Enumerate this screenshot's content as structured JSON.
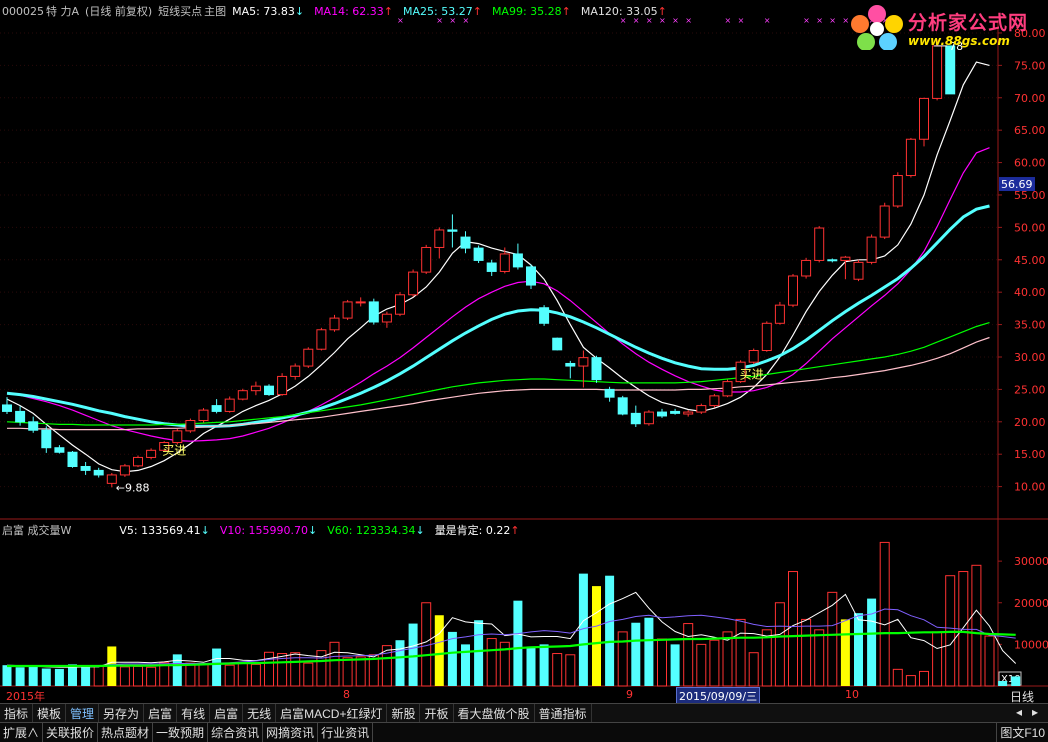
{
  "header": {
    "code": "000025",
    "name": "特 力A",
    "mode": "(日线 前复权)",
    "formula": "短线买点",
    "chart_label": "主图",
    "ma5": "MA5: 73.83",
    "ma14": "MA14: 62.33",
    "ma25": "MA25: 53.27",
    "ma99": "MA99: 35.28",
    "ma120": "MA120: 33.05"
  },
  "logo": {
    "title": "分析家公式网",
    "url": "www.88gs.com"
  },
  "volume_header": {
    "label": "启富 成交量W",
    "v5": "V5: 133569.41",
    "v10": "V10: 155990.70",
    "v60": "V60: 123334.34",
    "signal": "量是肯定: 0.22"
  },
  "price_axis": [
    "80.00",
    "75.00",
    "70.00",
    "65.00",
    "60.00",
    "55.00",
    "50.00",
    "45.00",
    "40.00",
    "35.00",
    "30.00",
    "25.00",
    "20.00",
    "15.00",
    "10.00"
  ],
  "price_marker": "56.69",
  "annotations": {
    "high": "78",
    "low": "9.88",
    "buy1": "买进",
    "buy2": "买进"
  },
  "volume_axis": [
    "30000",
    "20000",
    "10000"
  ],
  "volume_unit": "X10",
  "dates": {
    "start": "2015年",
    "m8": "8",
    "m9": "9",
    "cursor": "2015/09/09/三",
    "m10": "10"
  },
  "period": "日线",
  "toolbar": [
    "指标",
    "模板",
    "管理",
    "另存为",
    "启富",
    "有线",
    "启富",
    "无线",
    "启富MACD+红绿灯",
    "新股",
    "开板",
    "看大盘做个股",
    "普通指标"
  ],
  "toolbar_active": 2,
  "tabs": [
    "扩展∧",
    "关联报价",
    "热点题材",
    "一致预期",
    "综合资讯",
    "网摘资讯",
    "行业资讯"
  ],
  "tab_right": "图文F10",
  "colors": {
    "up": "#ff3232",
    "down": "#54ffff",
    "ma5": "#ffffff",
    "ma14": "#ff00ff",
    "ma25": "#54ffff",
    "ma99": "#00ff00",
    "ma120": "#ffc0cb",
    "signal": "#ffff00"
  },
  "chart_data": {
    "type": "candlestick",
    "ylim": [
      5,
      82
    ],
    "candles": [
      [
        22.6,
        23.8,
        21.2,
        21.6
      ],
      [
        21.6,
        22.4,
        19.4,
        20.0
      ],
      [
        20.0,
        20.8,
        18.3,
        18.7
      ],
      [
        18.7,
        19.3,
        15.2,
        16.0
      ],
      [
        16.0,
        16.4,
        15.1,
        15.3
      ],
      [
        15.3,
        15.5,
        12.9,
        13.1
      ],
      [
        13.1,
        13.8,
        11.8,
        12.5
      ],
      [
        12.5,
        12.9,
        11.4,
        11.8
      ],
      [
        10.5,
        12.1,
        9.88,
        11.8
      ],
      [
        11.8,
        13.5,
        11.5,
        13.2
      ],
      [
        13.2,
        14.8,
        13.0,
        14.5
      ],
      [
        14.5,
        15.9,
        14.2,
        15.6
      ],
      [
        15.6,
        17.0,
        15.4,
        16.8
      ],
      [
        16.8,
        18.9,
        16.5,
        18.6
      ],
      [
        18.6,
        20.5,
        18.3,
        20.2
      ],
      [
        20.2,
        22.1,
        19.9,
        21.8
      ],
      [
        22.5,
        23.5,
        21.3,
        21.6
      ],
      [
        21.6,
        23.9,
        21.4,
        23.5
      ],
      [
        23.5,
        25.1,
        23.3,
        24.8
      ],
      [
        24.8,
        26.2,
        24.1,
        25.5
      ],
      [
        25.5,
        25.8,
        24.0,
        24.2
      ],
      [
        24.2,
        27.5,
        24.0,
        27.0
      ],
      [
        27.0,
        29.0,
        26.5,
        28.6
      ],
      [
        28.6,
        31.5,
        28.3,
        31.2
      ],
      [
        31.2,
        34.5,
        31.0,
        34.2
      ],
      [
        34.2,
        36.5,
        33.9,
        36.0
      ],
      [
        36.0,
        38.8,
        35.7,
        38.5
      ],
      [
        38.5,
        39.2,
        37.8,
        38.5
      ],
      [
        38.5,
        39.0,
        35.0,
        35.4
      ],
      [
        35.4,
        37.0,
        34.5,
        36.6
      ],
      [
        36.6,
        40.0,
        36.3,
        39.6
      ],
      [
        39.6,
        43.5,
        39.3,
        43.1
      ],
      [
        43.1,
        47.3,
        42.8,
        46.9
      ],
      [
        46.9,
        50.0,
        45.2,
        49.6
      ],
      [
        49.6,
        52.0,
        46.9,
        49.4
      ],
      [
        48.5,
        49.4,
        46.0,
        46.8
      ],
      [
        46.8,
        47.2,
        44.5,
        44.9
      ],
      [
        44.5,
        45.0,
        42.5,
        43.2
      ],
      [
        43.2,
        46.9,
        42.9,
        45.9
      ],
      [
        45.9,
        47.5,
        43.5,
        43.9
      ],
      [
        43.9,
        44.3,
        40.5,
        41.1
      ],
      [
        37.6,
        38.0,
        34.8,
        35.2
      ],
      [
        32.9,
        33.0,
        31.0,
        31.1
      ],
      [
        29.0,
        29.4,
        26.7,
        28.6
      ],
      [
        28.6,
        31.0,
        25.3,
        29.9
      ],
      [
        29.9,
        30.2,
        26.0,
        26.5
      ],
      [
        25.0,
        25.4,
        23.1,
        23.8
      ],
      [
        23.7,
        24.0,
        21.0,
        21.2
      ],
      [
        21.3,
        22.5,
        19.2,
        19.7
      ],
      [
        19.7,
        21.8,
        19.4,
        21.5
      ],
      [
        21.5,
        22.0,
        20.6,
        20.9
      ],
      [
        21.6,
        22.0,
        21.1,
        21.3
      ],
      [
        21.2,
        21.8,
        20.8,
        21.5
      ],
      [
        21.5,
        22.8,
        21.2,
        22.5
      ],
      [
        22.5,
        24.3,
        22.2,
        24.0
      ],
      [
        24.0,
        26.5,
        23.8,
        26.2
      ],
      [
        26.2,
        29.5,
        26.0,
        29.2
      ],
      [
        29.2,
        31.3,
        28.9,
        31.0
      ],
      [
        31.0,
        35.5,
        30.8,
        35.2
      ],
      [
        35.2,
        38.5,
        35.0,
        38.0
      ],
      [
        38.0,
        42.8,
        37.7,
        42.5
      ],
      [
        42.5,
        45.3,
        42.1,
        44.9
      ],
      [
        44.9,
        50.2,
        44.6,
        49.9
      ],
      [
        45.0,
        45.2,
        44.6,
        44.9
      ],
      [
        44.9,
        45.6,
        42.0,
        45.4
      ],
      [
        42.0,
        45.0,
        41.7,
        44.6
      ],
      [
        44.6,
        48.9,
        44.3,
        48.5
      ],
      [
        48.5,
        53.8,
        48.2,
        53.3
      ],
      [
        53.3,
        58.5,
        53.0,
        58.0
      ],
      [
        58.0,
        63.8,
        57.7,
        63.6
      ],
      [
        63.6,
        70.0,
        62.5,
        69.9
      ],
      [
        69.9,
        79.0,
        69.6,
        78.0
      ],
      [
        78.0,
        78.0,
        70.6,
        70.6
      ]
    ],
    "ma_series": [
      {
        "name": "MA5",
        "values": [
          23.5,
          22.5,
          21.3,
          19.6,
          18.0,
          16.4,
          15.0,
          13.5,
          12.6,
          12.3,
          12.5,
          13.1,
          14.0,
          15.2,
          16.6,
          18.2,
          19.3,
          20.4,
          21.6,
          22.5,
          23.3,
          24.3,
          25.5,
          27.0,
          28.8,
          30.7,
          32.8,
          34.5,
          36.3,
          37.4,
          38.1,
          39.2,
          40.8,
          43.1,
          46.0,
          47.8,
          47.5,
          46.8,
          46.3,
          45.8,
          44.2,
          42.0,
          38.7,
          35.0,
          31.5,
          29.8,
          28.3,
          26.7,
          25.3,
          24.0,
          23.0,
          22.5,
          21.9,
          21.6,
          22.1,
          22.8,
          23.8,
          25.3,
          27.3,
          30.0,
          33.4,
          37.0,
          40.1,
          42.6,
          44.7,
          45.0,
          45.0,
          45.6,
          47.3,
          50.5,
          55.0,
          61.2,
          66.5,
          72.0,
          75.5,
          75.0
        ]
      },
      {
        "name": "MA14",
        "values": [
          24.4,
          24.1,
          23.6,
          23.1,
          22.5,
          21.8,
          21.0,
          20.2,
          19.4,
          18.8,
          18.3,
          17.8,
          17.4,
          17.1,
          17.0,
          17.1,
          17.2,
          17.4,
          17.8,
          18.4,
          19.0,
          19.8,
          20.7,
          21.6,
          22.6,
          23.7,
          24.9,
          26.1,
          27.4,
          28.6,
          29.9,
          31.4,
          33.0,
          34.6,
          36.2,
          37.7,
          39.0,
          40.0,
          40.9,
          41.5,
          41.7,
          41.3,
          40.2,
          38.7,
          37.0,
          35.3,
          33.6,
          32.0,
          30.5,
          29.2,
          28.1,
          27.1,
          26.2,
          25.5,
          24.9,
          24.6,
          24.6,
          24.8,
          25.3,
          26.1,
          27.3,
          29.0,
          30.9,
          32.8,
          34.5,
          36.2,
          37.9,
          39.5,
          41.3,
          43.5,
          46.3,
          50.1,
          54.3,
          58.4,
          61.5,
          62.3
        ]
      },
      {
        "name": "MA25",
        "values": [
          24.4,
          24.2,
          23.9,
          23.5,
          23.1,
          22.7,
          22.2,
          21.7,
          21.3,
          20.8,
          20.4,
          20.0,
          19.7,
          19.5,
          19.3,
          19.3,
          19.3,
          19.4,
          19.6,
          19.9,
          20.2,
          20.6,
          21.0,
          21.5,
          22.1,
          22.8,
          23.6,
          24.4,
          25.3,
          26.3,
          27.4,
          28.6,
          29.9,
          31.2,
          32.5,
          33.7,
          34.8,
          35.8,
          36.6,
          37.1,
          37.3,
          37.2,
          36.8,
          36.2,
          35.4,
          34.5,
          33.5,
          32.5,
          31.5,
          30.6,
          29.8,
          29.1,
          28.6,
          28.2,
          28.1,
          28.1,
          28.3,
          28.7,
          29.4,
          30.2,
          31.3,
          32.6,
          34.1,
          35.6,
          37.0,
          38.3,
          39.5,
          40.8,
          42.1,
          43.7,
          45.5,
          47.6,
          49.7,
          51.6,
          52.8,
          53.3
        ]
      },
      {
        "name": "MA99",
        "values": [
          20.0,
          19.9,
          19.8,
          19.7,
          19.6,
          19.6,
          19.5,
          19.5,
          19.5,
          19.5,
          19.5,
          19.5,
          19.6,
          19.6,
          19.7,
          19.8,
          19.9,
          20.0,
          20.2,
          20.4,
          20.6,
          20.8,
          21.1,
          21.4,
          21.7,
          22.0,
          22.3,
          22.6,
          23.0,
          23.4,
          23.8,
          24.2,
          24.6,
          25.0,
          25.4,
          25.7,
          26.0,
          26.2,
          26.4,
          26.5,
          26.6,
          26.6,
          26.5,
          26.4,
          26.3,
          26.2,
          26.1,
          26.0,
          26.0,
          26.0,
          26.0,
          26.0,
          26.1,
          26.2,
          26.4,
          26.6,
          26.8,
          27.0,
          27.3,
          27.6,
          27.9,
          28.2,
          28.5,
          28.8,
          29.1,
          29.4,
          29.7,
          30.0,
          30.4,
          30.9,
          31.5,
          32.3,
          33.1,
          33.9,
          34.7,
          35.3
        ]
      },
      {
        "name": "MA120",
        "values": [
          19.0,
          19.0,
          18.9,
          18.9,
          18.8,
          18.8,
          18.8,
          18.8,
          18.8,
          18.8,
          18.9,
          18.9,
          19.0,
          19.0,
          19.1,
          19.2,
          19.3,
          19.4,
          19.6,
          19.7,
          19.9,
          20.1,
          20.3,
          20.5,
          20.7,
          21.0,
          21.3,
          21.6,
          21.9,
          22.2,
          22.5,
          22.8,
          23.2,
          23.5,
          23.8,
          24.1,
          24.4,
          24.6,
          24.8,
          24.9,
          25.0,
          25.0,
          25.0,
          25.0,
          25.0,
          25.0,
          24.9,
          24.9,
          24.9,
          24.9,
          24.9,
          24.9,
          25.0,
          25.0,
          25.1,
          25.2,
          25.4,
          25.5,
          25.7,
          25.9,
          26.1,
          26.3,
          26.5,
          26.8,
          27.0,
          27.3,
          27.6,
          27.9,
          28.3,
          28.7,
          29.2,
          29.8,
          30.5,
          31.4,
          32.3,
          33.0
        ]
      }
    ],
    "volume": [
      5000,
      4500,
      4800,
      4200,
      4100,
      5200,
      4800,
      4700,
      9500,
      4600,
      4700,
      4500,
      5600,
      7600,
      5500,
      5200,
      9000,
      5000,
      5500,
      5200,
      8100,
      7800,
      8000,
      5500,
      8500,
      10500,
      6800,
      7000,
      7500,
      9700,
      11000,
      15000,
      20000,
      17000,
      13000,
      10000,
      15800,
      11400,
      10500,
      20500,
      9500,
      10000,
      7800,
      7500,
      27000,
      24000,
      26500,
      13000,
      15200,
      16400,
      11300,
      10000,
      15000,
      10000,
      11000,
      13000,
      16000,
      8000,
      13500,
      20000,
      27500,
      16000,
      13500,
      22500,
      16000,
      17500,
      21000,
      34500,
      4000,
      2500,
      3500,
      13000,
      26500,
      27500,
      29000,
      12000,
      1200,
      2300
    ],
    "volume_colors": [
      "d",
      "d",
      "d",
      "d",
      "d",
      "d",
      "d",
      "u",
      "y",
      "u",
      "u",
      "u",
      "u",
      "d",
      "u",
      "u",
      "d",
      "u",
      "u",
      "u",
      "u",
      "u",
      "u",
      "u",
      "u",
      "u",
      "u",
      "u",
      "u",
      "u",
      "d",
      "d",
      "u",
      "y",
      "d",
      "d",
      "d",
      "u",
      "u",
      "d",
      "d",
      "d",
      "u",
      "u",
      "d",
      "y",
      "d",
      "u",
      "d",
      "d",
      "u",
      "d",
      "u",
      "u",
      "u",
      "u",
      "u",
      "u",
      "u",
      "u",
      "u",
      "u",
      "u",
      "u",
      "y",
      "d",
      "d",
      "u",
      "u",
      "u",
      "u",
      "u",
      "u",
      "u",
      "u",
      "u",
      "d",
      "d"
    ],
    "vol_ma": [
      {
        "name": "V5",
        "values": [
          5000,
          4900,
          4800,
          4600,
          4500,
          4500,
          4600,
          4600,
          5700,
          5700,
          5700,
          5600,
          5800,
          6200,
          6000,
          5700,
          6600,
          6600,
          6200,
          6100,
          6600,
          7100,
          7700,
          7300,
          7000,
          8100,
          8000,
          7500,
          7000,
          8600,
          8900,
          9600,
          10600,
          12600,
          16400,
          15400,
          15100,
          14900,
          12100,
          12500,
          11800,
          11900,
          11900,
          11400,
          15700,
          17600,
          19700,
          21000,
          22500,
          18700,
          15400,
          13100,
          11900,
          12300,
          11700,
          11000,
          12700,
          12600,
          12000,
          12400,
          14500,
          15800,
          17600,
          19400,
          22000,
          15900,
          15600,
          14700,
          16000,
          11600,
          10900,
          9000,
          9900,
          14000,
          18200,
          14400,
          8500,
          5400
        ]
      },
      {
        "name": "V10",
        "values": [
          5000,
          4900,
          4900,
          4800,
          4700,
          4700,
          4700,
          4700,
          5200,
          5300,
          5300,
          5300,
          5300,
          5400,
          5400,
          5400,
          5500,
          5600,
          5800,
          6000,
          6400,
          6600,
          6800,
          6800,
          6700,
          7100,
          7200,
          7300,
          7400,
          7900,
          8500,
          9100,
          9700,
          10500,
          11400,
          11800,
          12300,
          12500,
          12300,
          12600,
          13000,
          13300,
          13100,
          12700,
          13800,
          14400,
          15500,
          16000,
          16700,
          17000,
          16400,
          16600,
          16900,
          17000,
          16600,
          16200,
          15600,
          14800,
          14300,
          14400,
          14300,
          14400,
          14400,
          14500,
          15700,
          16900,
          17300,
          18500,
          18300,
          16900,
          15900,
          14100,
          13900,
          13600,
          13600,
          12200,
          11900,
          11500
        ]
      },
      {
        "name": "V60",
        "values": [
          4800,
          4800,
          4800,
          4800,
          4800,
          4800,
          4800,
          4800,
          4900,
          4900,
          4900,
          4900,
          5000,
          5000,
          5100,
          5200,
          5300,
          5400,
          5500,
          5500,
          5600,
          5700,
          5800,
          5900,
          6000,
          6200,
          6300,
          6400,
          6500,
          6700,
          6900,
          7100,
          7400,
          7700,
          8000,
          8200,
          8400,
          8600,
          8800,
          9100,
          9300,
          9400,
          9500,
          9600,
          10000,
          10300,
          10600,
          10700,
          10900,
          11000,
          11100,
          11200,
          11300,
          11300,
          11400,
          11500,
          11600,
          11600,
          11700,
          11900,
          12000,
          12100,
          12200,
          12300,
          12400,
          12500,
          12600,
          12700,
          12700,
          12800,
          12900,
          12900,
          13000,
          13000,
          12700,
          12500,
          12400,
          12300
        ]
      }
    ],
    "volume_ylim": [
      0,
      37000
    ]
  }
}
